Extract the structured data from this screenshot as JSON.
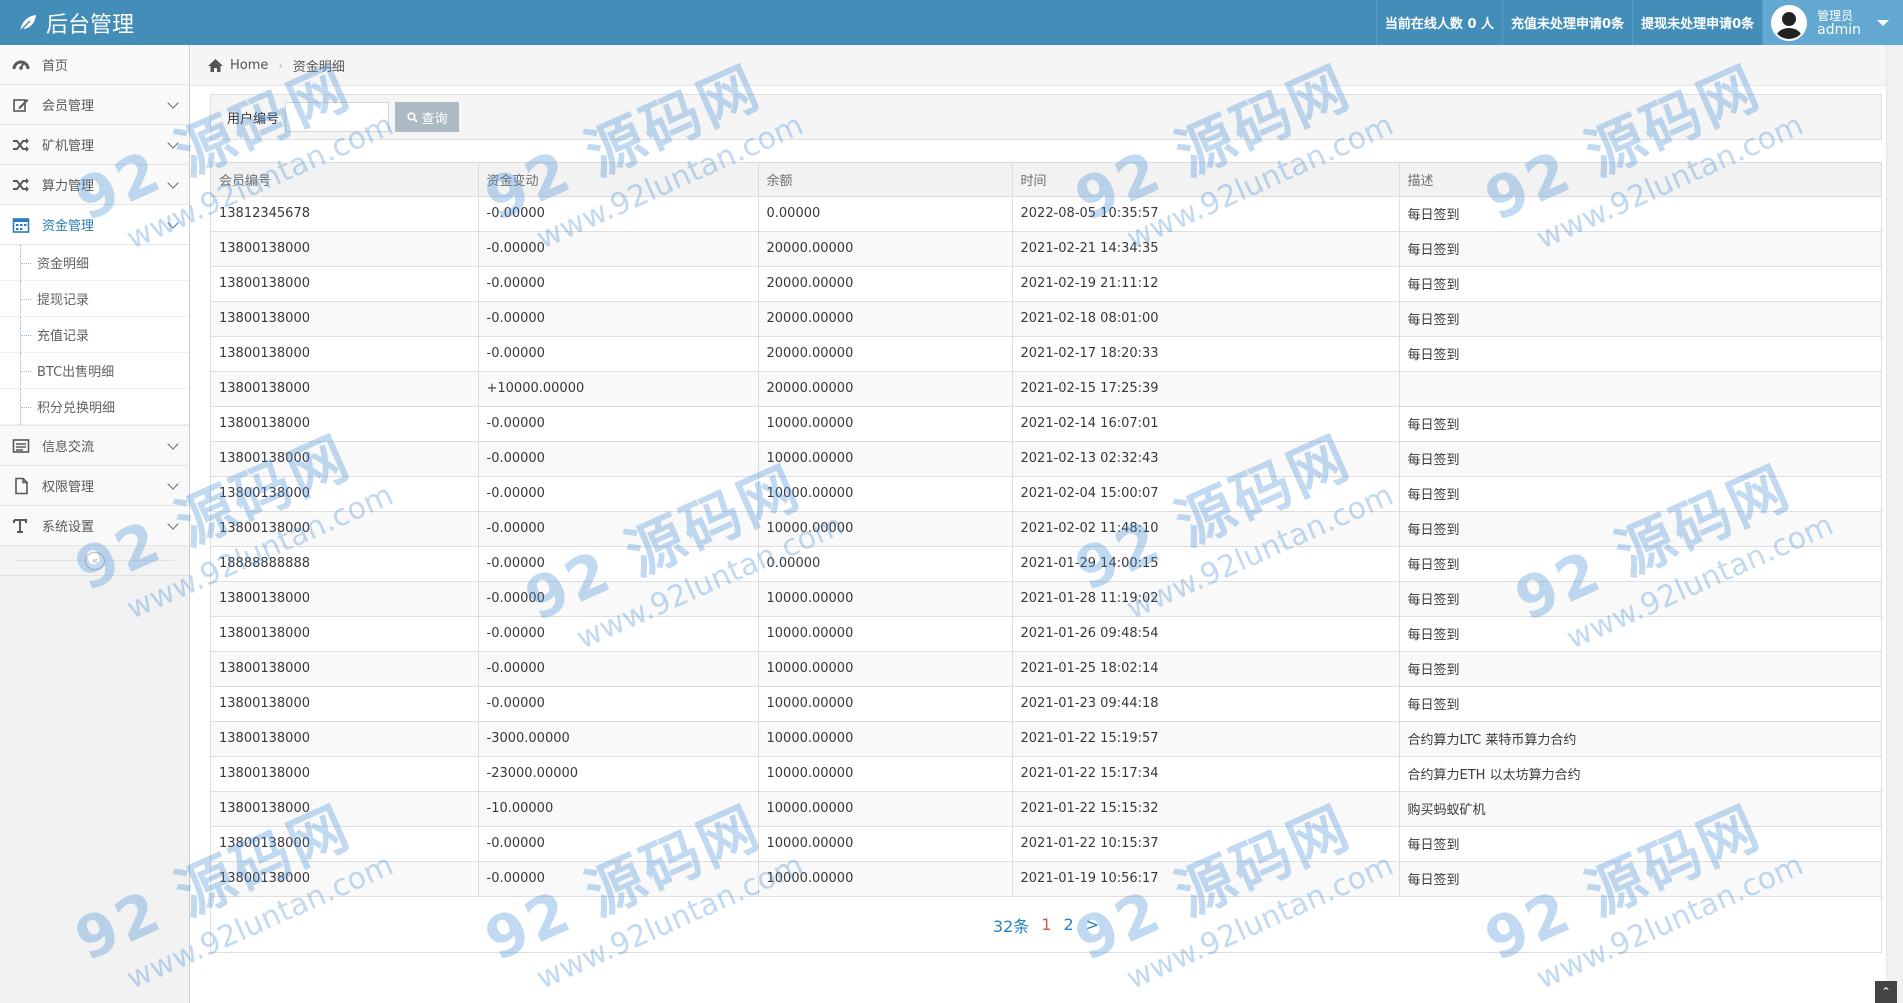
{
  "app": {
    "title": "后台管理"
  },
  "navbar": {
    "online": "当前在线人数 0 人",
    "recharge_pending": "充值未处理申请0条",
    "withdraw_pending": "提现未处理申请0条",
    "user_role": "管理员",
    "user_name": "admin"
  },
  "sidebar": {
    "items": [
      {
        "label": "首页",
        "icon": "dashboard-icon"
      },
      {
        "label": "会员管理",
        "icon": "edit-icon"
      },
      {
        "label": "矿机管理",
        "icon": "shuffle-icon"
      },
      {
        "label": "算力管理",
        "icon": "shuffle-icon"
      },
      {
        "label": "资金管理",
        "icon": "calendar-icon"
      },
      {
        "label": "信息交流",
        "icon": "list-icon"
      },
      {
        "label": "权限管理",
        "icon": "file-icon"
      },
      {
        "label": "系统设置",
        "icon": "text-icon"
      }
    ],
    "sub_items": [
      "资金明细",
      "提现记录",
      "充值记录",
      "BTC出售明细",
      "积分兑换明细"
    ],
    "collapse_glyph": "«"
  },
  "breadcrumb": {
    "home": "Home",
    "current": "资金明细"
  },
  "search": {
    "label": "用户编号",
    "value": "",
    "placeholder": "",
    "button": "查询"
  },
  "table": {
    "headers": [
      "会员编号",
      "资金变动",
      "余额",
      "时间",
      "描述"
    ],
    "rows": [
      [
        "13812345678",
        "-0.00000",
        "0.00000",
        "2022-08-05 10:35:57",
        "每日签到"
      ],
      [
        "13800138000",
        "-0.00000",
        "20000.00000",
        "2021-02-21 14:34:35",
        "每日签到"
      ],
      [
        "13800138000",
        "-0.00000",
        "20000.00000",
        "2021-02-19 21:11:12",
        "每日签到"
      ],
      [
        "13800138000",
        "-0.00000",
        "20000.00000",
        "2021-02-18 08:01:00",
        "每日签到"
      ],
      [
        "13800138000",
        "-0.00000",
        "20000.00000",
        "2021-02-17 18:20:33",
        "每日签到"
      ],
      [
        "13800138000",
        "+10000.00000",
        "20000.00000",
        "2021-02-15 17:25:39",
        ""
      ],
      [
        "13800138000",
        "-0.00000",
        "10000.00000",
        "2021-02-14 16:07:01",
        "每日签到"
      ],
      [
        "13800138000",
        "-0.00000",
        "10000.00000",
        "2021-02-13 02:32:43",
        "每日签到"
      ],
      [
        "13800138000",
        "-0.00000",
        "10000.00000",
        "2021-02-04 15:00:07",
        "每日签到"
      ],
      [
        "13800138000",
        "-0.00000",
        "10000.00000",
        "2021-02-02 11:48:10",
        "每日签到"
      ],
      [
        "18888888888",
        "-0.00000",
        "0.00000",
        "2021-01-29 14:00:15",
        "每日签到"
      ],
      [
        "13800138000",
        "-0.00000",
        "10000.00000",
        "2021-01-28 11:19:02",
        "每日签到"
      ],
      [
        "13800138000",
        "-0.00000",
        "10000.00000",
        "2021-01-26 09:48:54",
        "每日签到"
      ],
      [
        "13800138000",
        "-0.00000",
        "10000.00000",
        "2021-01-25 18:02:14",
        "每日签到"
      ],
      [
        "13800138000",
        "-0.00000",
        "10000.00000",
        "2021-01-23 09:44:18",
        "每日签到"
      ],
      [
        "13800138000",
        "-3000.00000",
        "10000.00000",
        "2021-01-22 15:19:57",
        "合约算力LTC 莱特币算力合约"
      ],
      [
        "13800138000",
        "-23000.00000",
        "10000.00000",
        "2021-01-22 15:17:34",
        "合约算力ETH 以太坊算力合约"
      ],
      [
        "13800138000",
        "-10.00000",
        "10000.00000",
        "2021-01-22 15:15:32",
        "购买蚂蚁矿机"
      ],
      [
        "13800138000",
        "-0.00000",
        "10000.00000",
        "2021-01-22 10:15:37",
        "每日签到"
      ],
      [
        "13800138000",
        "-0.00000",
        "10000.00000",
        "2021-01-19 10:56:17",
        "每日签到"
      ]
    ]
  },
  "pagination": {
    "total": "32条",
    "current": "1",
    "next_page": "2",
    "next": ">"
  },
  "scroll_top_glyph": "⌃",
  "watermark": {
    "big": "92 源码网",
    "small": "www.92luntan.com"
  },
  "colors": {
    "navbar": "#438eb9",
    "accent": "#2b7dbc",
    "active_page": "#d15b47"
  }
}
